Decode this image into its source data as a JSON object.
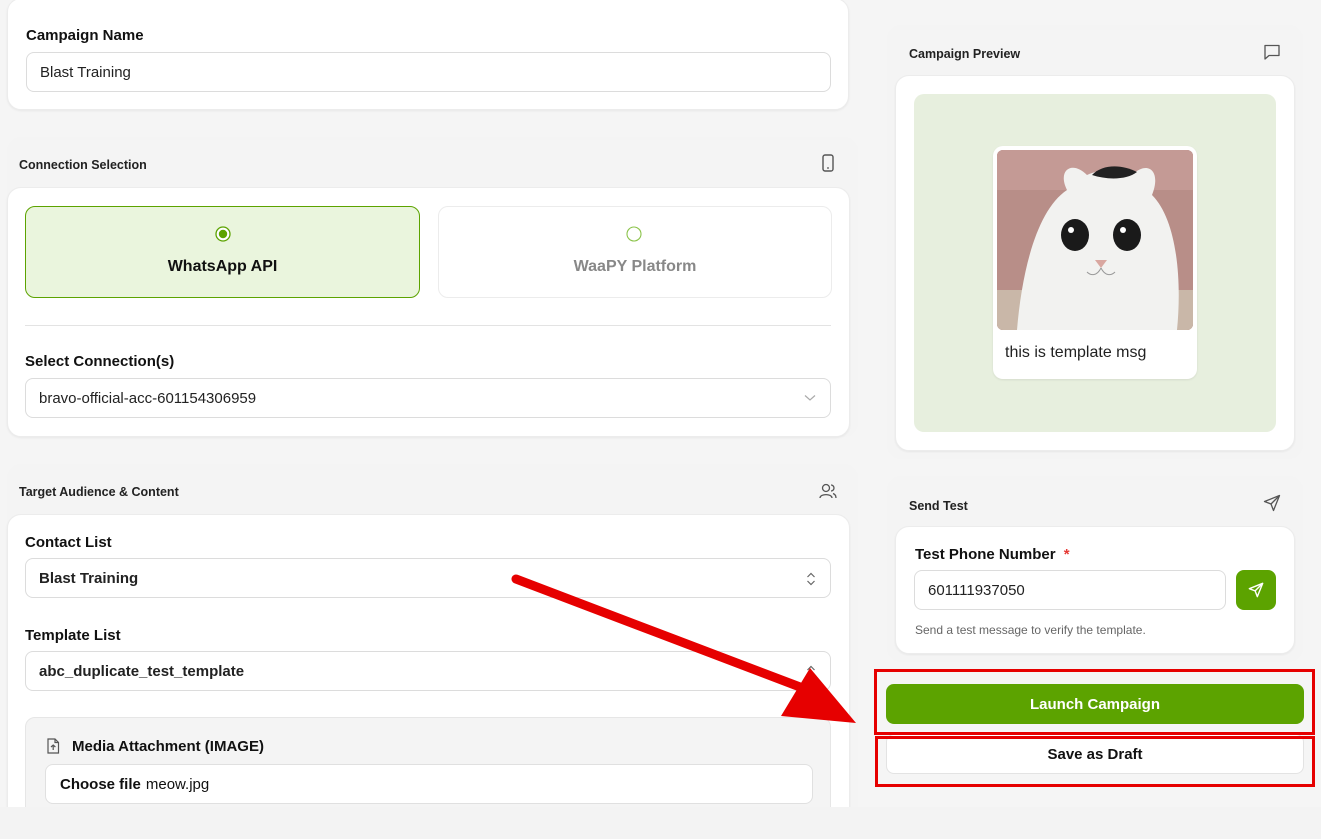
{
  "campaign": {
    "label": "Campaign Name",
    "value": "Blast Training"
  },
  "connection_selection": {
    "title": "Connection Selection",
    "options": [
      {
        "label": "WhatsApp API",
        "selected": true
      },
      {
        "label": "WaaPY Platform",
        "selected": false
      }
    ],
    "select_label": "Select Connection(s)",
    "select_value": "bravo-official-acc-601154306959"
  },
  "target": {
    "title": "Target Audience & Content",
    "contact_label": "Contact List",
    "contact_value": "Blast Training",
    "template_label": "Template List",
    "template_value": "abc_duplicate_test_template",
    "media_label": "Media Attachment (IMAGE)",
    "choose_file": "Choose file",
    "file_name": "meow.jpg"
  },
  "preview": {
    "title": "Campaign Preview",
    "message": "this is template msg"
  },
  "send_test": {
    "title": "Send Test",
    "phone_label": "Test Phone Number",
    "required_mark": "*",
    "phone_value": "601111937050",
    "hint": "Send a test message to verify the template."
  },
  "actions": {
    "launch": "Launch Campaign",
    "draft": "Save as Draft"
  },
  "colors": {
    "accent": "#5ca300",
    "selected_bg": "#eaf5dd",
    "annotation": "#e60000"
  }
}
